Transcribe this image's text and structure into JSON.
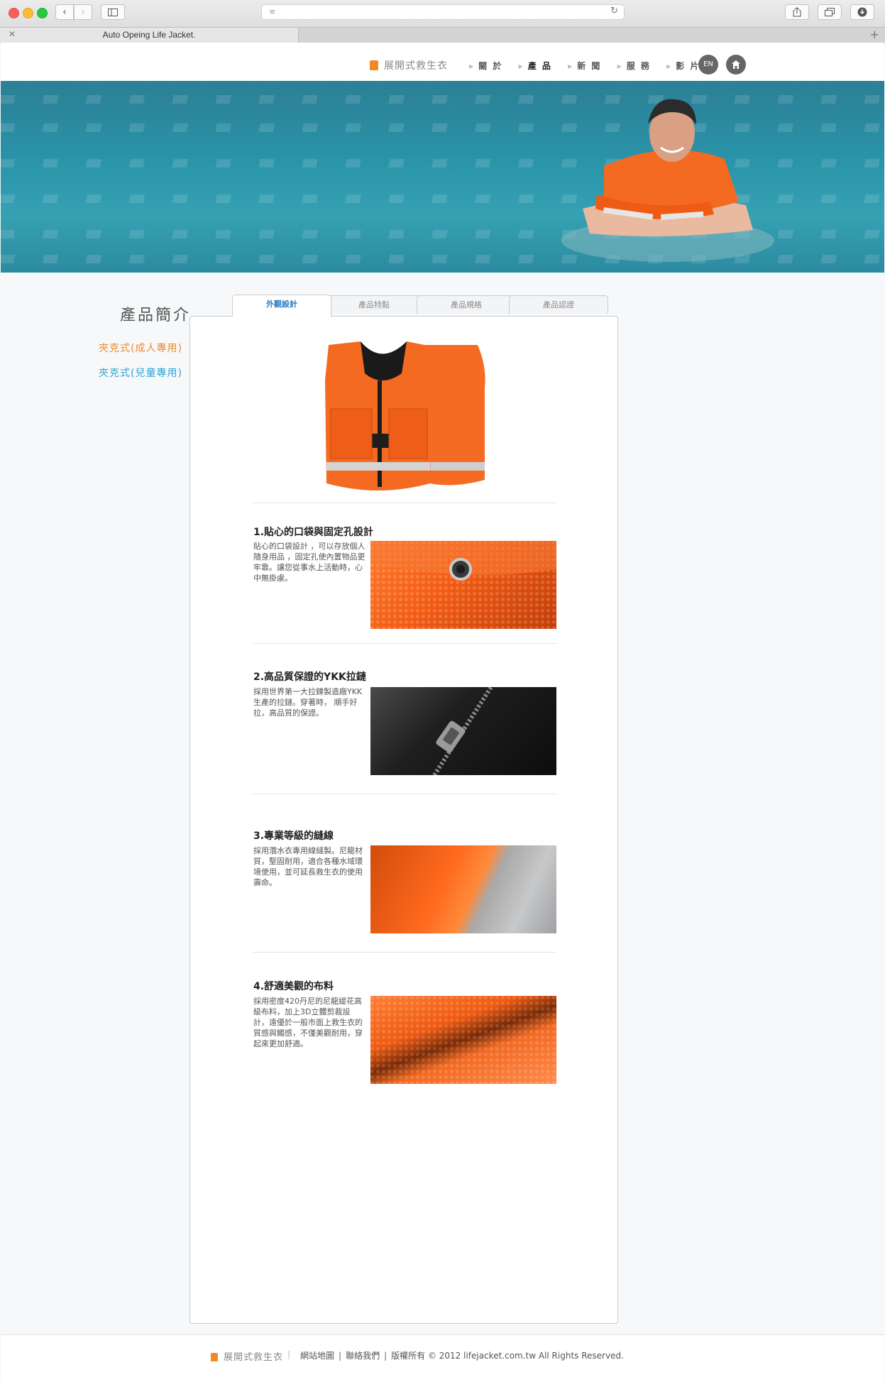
{
  "browser": {
    "tab_title": "Auto Opeing Life Jacket.",
    "close_glyph": "✕",
    "new_tab_glyph": "+"
  },
  "header": {
    "brand": "展開式救生衣",
    "nav": [
      "關 於",
      "產 品",
      "新 聞",
      "服 務",
      "影 片"
    ],
    "active_nav": "產 品",
    "lang_button": "EN",
    "home_icon": "home-icon"
  },
  "sidebar": {
    "title": "產品簡介",
    "links": [
      "夾克式(成人專用)",
      "夾克式(兒童專用)"
    ]
  },
  "tabs": {
    "items": [
      "外觀設計",
      "產品特點",
      "產品規格",
      "產品認證"
    ],
    "active": "外觀設計"
  },
  "features": [
    {
      "title": "1.貼心的口袋與固定孔設計",
      "text": "貼心的口袋設計 ，可以存放個人隨身用品 ，固定孔使內置物品更牢靠。讓您從事水上活動時，心中無掛慮。"
    },
    {
      "title": "2.高品質保證的YKK拉鏈",
      "text": "採用世界第一大拉鍊製造廠YKK生產的拉鏈。穿著時， 順手好拉，高品質的保證。"
    },
    {
      "title": "3.專業等級的縫線",
      "text": "採用潛水衣專用線縫製。尼龍材質，堅固耐用，適合各種水域環境使用，並可延長救生衣的使用壽命。"
    },
    {
      "title": "4.舒適美觀的布料",
      "text": "採用密度420丹尼的尼龍緹花高級布料，加上3D立體剪裁設計，遠優於一般市面上救生衣的質感與觸感，不僅美觀耐用，穿起來更加舒適。"
    }
  ],
  "footer": {
    "brand": "展開式救生衣",
    "divider": "|",
    "sitemap": "網站地圖",
    "contact": "聯絡我們",
    "copyright": "版權所有 © 2012 lifejacket.com.tw All Rights Reserved.",
    "bar": "|"
  },
  "colors": {
    "accent_orange": "#f08a24",
    "accent_blue": "#2aa6d6",
    "tab_active_text": "#2a7bc0"
  }
}
